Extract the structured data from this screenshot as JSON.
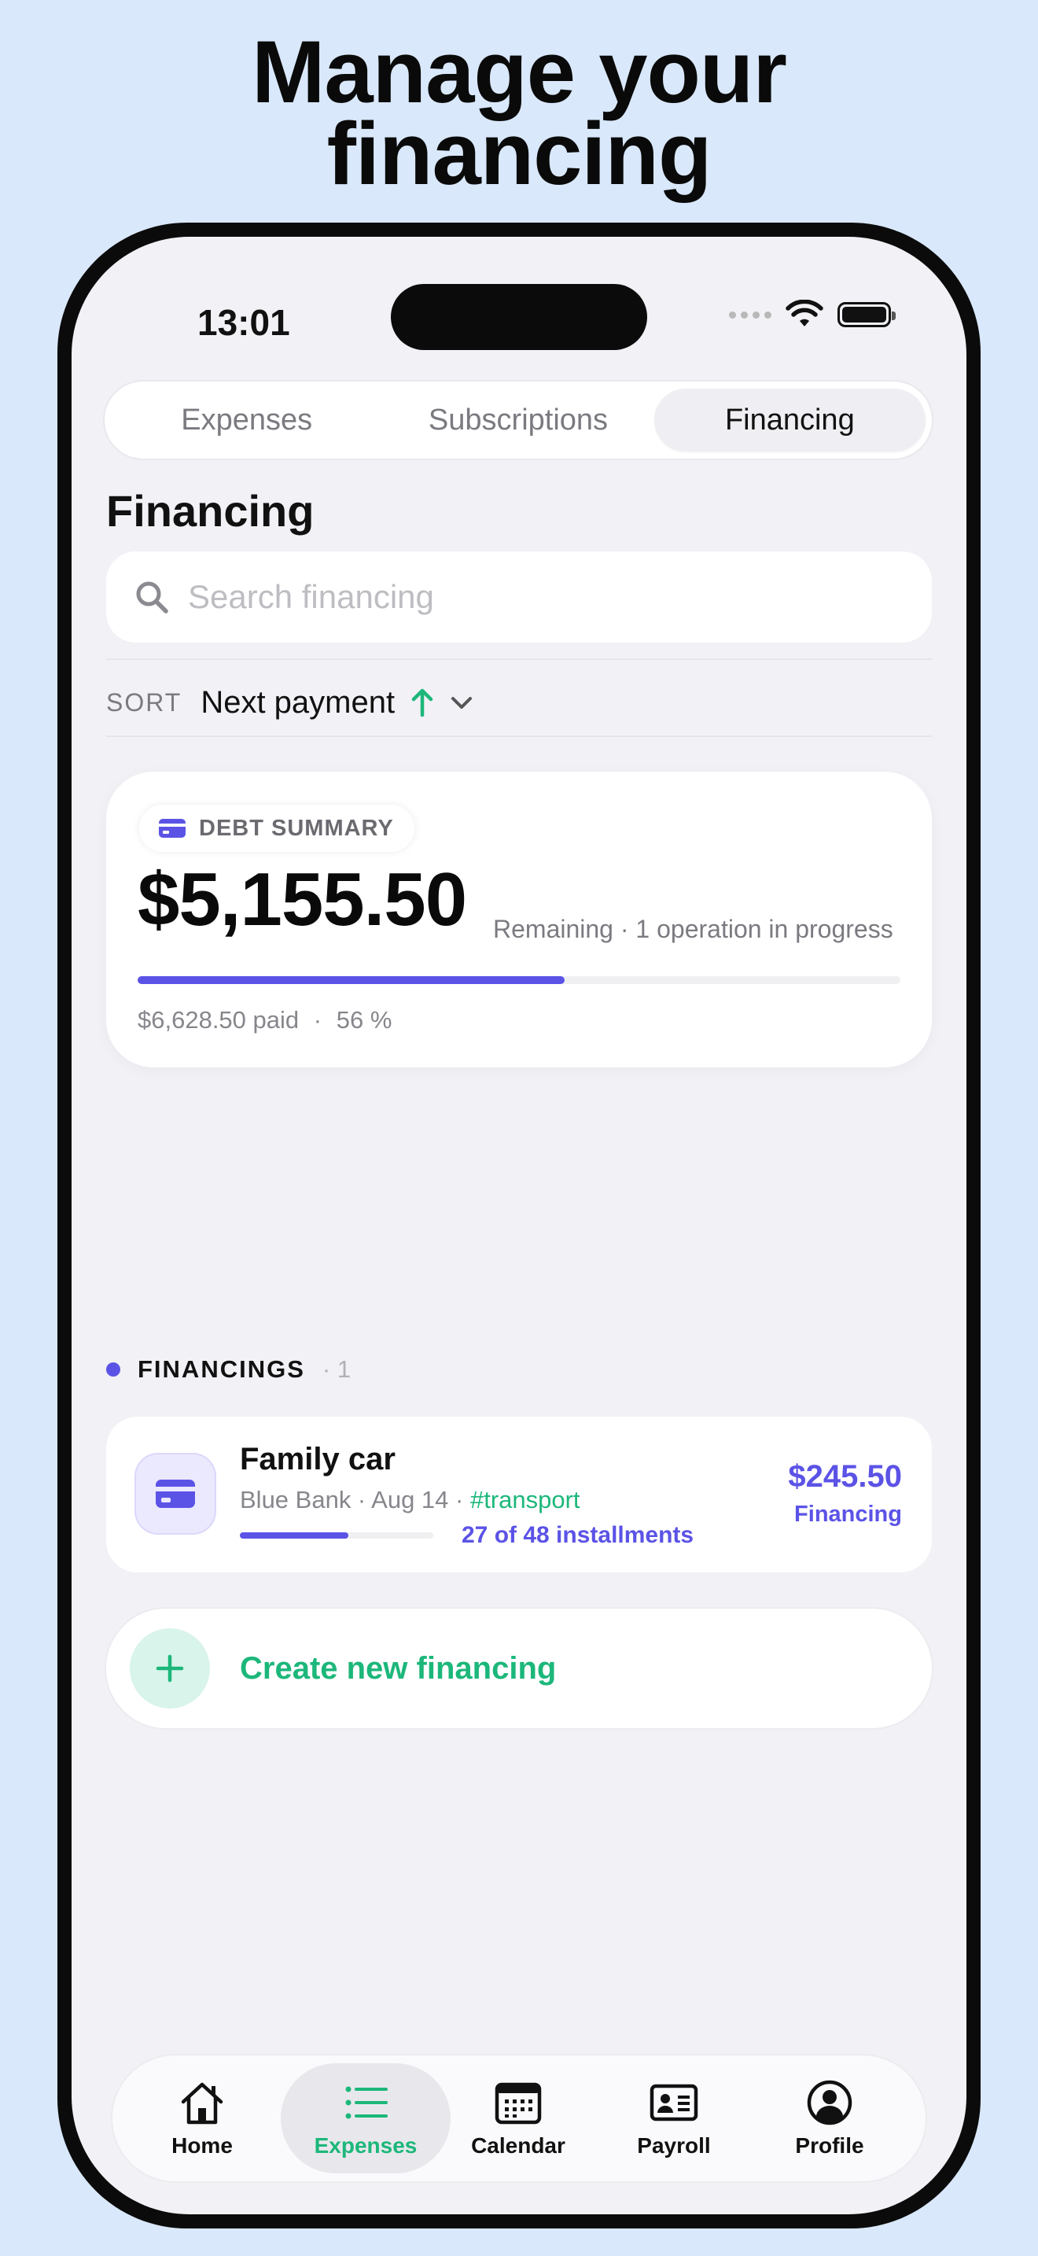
{
  "headline": {
    "line1": "Manage your",
    "line2": "financing"
  },
  "status_bar": {
    "time": "13:01"
  },
  "segments": [
    {
      "label": "Expenses",
      "active": false
    },
    {
      "label": "Subscriptions",
      "active": false
    },
    {
      "label": "Financing",
      "active": true
    }
  ],
  "page": {
    "title": "Financing"
  },
  "search": {
    "placeholder": "Search financing",
    "value": ""
  },
  "sort": {
    "label": "SORT",
    "value": "Next payment"
  },
  "summary": {
    "badge": "DEBT SUMMARY",
    "amount": "$5,155.50",
    "remaining_text": "Remaining · 1 operation in progress",
    "paid_text": "$6,628.50 paid",
    "percent_text": "56 %",
    "progress_fraction": 0.56
  },
  "section": {
    "title": "FINANCINGS",
    "count": "· 1"
  },
  "financings": [
    {
      "name": "Family car",
      "bank_date": "Blue Bank · Aug 14 · ",
      "tag": "#transport",
      "installments": "27 of 48 installments",
      "installments_fraction": 0.5625,
      "amount": "$245.50",
      "type": "Financing"
    }
  ],
  "create": {
    "label": "Create new financing"
  },
  "tabbar": [
    {
      "label": "Home",
      "icon": "house-icon",
      "active": false
    },
    {
      "label": "Expenses",
      "icon": "list-icon",
      "active": true
    },
    {
      "label": "Calendar",
      "icon": "calendar-icon",
      "active": false
    },
    {
      "label": "Payroll",
      "icon": "id-card-icon",
      "active": false
    },
    {
      "label": "Profile",
      "icon": "person-circle-icon",
      "active": false
    }
  ],
  "colors": {
    "accent": "#5b53e6",
    "green": "#1cb77a",
    "background": "#d9e8fa"
  }
}
